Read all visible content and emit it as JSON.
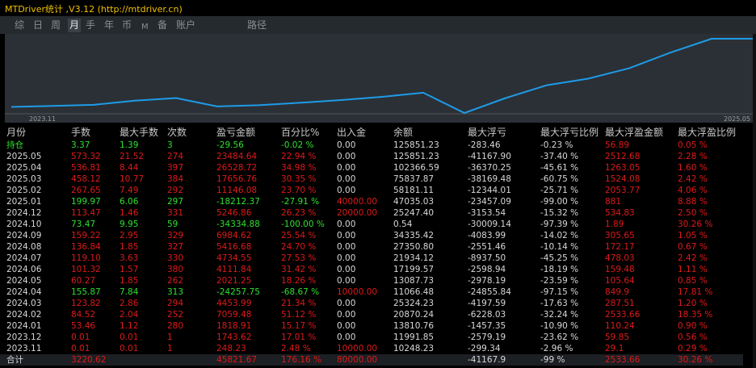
{
  "title": "MTDriver统计 ,V3.12 (http://mtdriver.cn)",
  "tabs": [
    {
      "label": "综"
    },
    {
      "label": "日"
    },
    {
      "label": "周"
    },
    {
      "label": "月",
      "active": true
    },
    {
      "label": "手"
    },
    {
      "label": "年"
    },
    {
      "label": "币"
    },
    {
      "label": "M"
    },
    {
      "label": "备"
    },
    {
      "label": "账户"
    },
    {
      "label": "路径"
    }
  ],
  "chart_data": {
    "type": "line",
    "x": [
      "2023.11",
      "2023.12",
      "2024.01",
      "2024.02",
      "2024.03",
      "2024.04",
      "2024.05",
      "2024.06",
      "2024.07",
      "2024.08",
      "2024.09",
      "2024.10",
      "2024.11",
      "2024.12",
      "2025.01",
      "2025.02",
      "2025.03",
      "2025.04",
      "2025.05"
    ],
    "y": [
      10248.23,
      11991.85,
      13810.76,
      20870.24,
      25324.23,
      11066.48,
      13087.73,
      17199.57,
      21934.12,
      27350.8,
      34335.42,
      0.54,
      25247.4,
      47035.03,
      58181.11,
      75837.87,
      102366.59,
      125851.23,
      125851.23
    ],
    "x_tick_labels": [
      "2023.11",
      "2025.05"
    ],
    "line_color": "#1e9be8"
  },
  "columns": [
    "月份",
    "手数",
    "最大手数",
    "次数",
    "盈亏金额",
    "百分比%",
    "出入金",
    "余额",
    "最大浮亏",
    "最大浮亏比例",
    "最大浮盈金额",
    "最大浮盈比例"
  ],
  "holding": [
    "持仓",
    "3.37",
    "1.39",
    "3",
    "-29.56",
    "-0.02 %",
    "0.00",
    "125851.23",
    "-283.46",
    "-0.23 %",
    "56.89",
    "0.05 %"
  ],
  "rows": [
    [
      "2025.05",
      "573.32",
      "21.52",
      "274",
      "23484.64",
      "22.94 %",
      "0.00",
      "125851.23",
      "-41167.90",
      "-37.40 %",
      "2512.68",
      "2.28 %"
    ],
    [
      "2025.04",
      "536.81",
      "8.44",
      "397",
      "26528.72",
      "34.98 %",
      "0.00",
      "102366.59",
      "-36370.25",
      "-45.61 %",
      "1263.05",
      "1.60 %"
    ],
    [
      "2025.03",
      "458.12",
      "10.77",
      "384",
      "17656.76",
      "30.35 %",
      "0.00",
      "75837.87",
      "-38169.48",
      "-60.75 %",
      "1524.08",
      "2.42 %"
    ],
    [
      "2025.02",
      "267.65",
      "7.49",
      "292",
      "11146.08",
      "23.70 %",
      "0.00",
      "58181.11",
      "-12344.01",
      "-25.71 %",
      "2053.77",
      "4.06 %"
    ],
    [
      "2025.01",
      "199.97",
      "6.06",
      "297",
      "-18212.37",
      "-27.91 %",
      "40000.00",
      "47035.03",
      "-23457.09",
      "-99.00 %",
      "881",
      "8.88 %"
    ],
    [
      "2024.12",
      "113.47",
      "1.46",
      "331",
      "5246.86",
      "26.23 %",
      "20000.00",
      "25247.40",
      "-3153.54",
      "-15.32 %",
      "534.83",
      "2.50 %"
    ],
    [
      "2024.10",
      "73.47",
      "9.95",
      "59",
      "-34334.88",
      "-100.00 %",
      "0.00",
      "0.54",
      "-30009.14",
      "-97.39 %",
      "1.89",
      "30.26 %"
    ],
    [
      "2024.09",
      "159.22",
      "2.95",
      "329",
      "6984.62",
      "25.54 %",
      "0.00",
      "34335.42",
      "-4083.99",
      "-14.02 %",
      "305.65",
      "1.05 %"
    ],
    [
      "2024.08",
      "136.84",
      "1.85",
      "327",
      "5416.68",
      "24.70 %",
      "0.00",
      "27350.80",
      "-2551.46",
      "-10.14 %",
      "172.17",
      "0.67 %"
    ],
    [
      "2024.07",
      "119.10",
      "3.63",
      "330",
      "4734.55",
      "27.53 %",
      "0.00",
      "21934.12",
      "-8937.50",
      "-45.25 %",
      "478.03",
      "2.42 %"
    ],
    [
      "2024.06",
      "101.32",
      "1.57",
      "380",
      "4111.84",
      "31.42 %",
      "0.00",
      "17199.57",
      "-2598.94",
      "-18.19 %",
      "159.48",
      "1.11 %"
    ],
    [
      "2024.05",
      "60.27",
      "1.85",
      "262",
      "2021.25",
      "18.26 %",
      "0.00",
      "13087.73",
      "-2978.19",
      "-23.59 %",
      "105.64",
      "0.85 %"
    ],
    [
      "2024.04",
      "155.87",
      "7.84",
      "313",
      "-24257.75",
      "-68.67 %",
      "10000.00",
      "11066.48",
      "-24855.84",
      "-97.15 %",
      "849.9",
      "17.81 %"
    ],
    [
      "2024.03",
      "123.82",
      "2.86",
      "294",
      "4453.99",
      "21.34 %",
      "0.00",
      "25324.23",
      "-4197.59",
      "-17.63 %",
      "287.51",
      "1.20 %"
    ],
    [
      "2024.02",
      "84.52",
      "2.04",
      "252",
      "7059.48",
      "51.12 %",
      "0.00",
      "20870.24",
      "-6228.03",
      "-32.24 %",
      "2533.66",
      "18.35 %"
    ],
    [
      "2024.01",
      "53.46",
      "1.12",
      "280",
      "1818.91",
      "15.17 %",
      "0.00",
      "13810.76",
      "-1457.35",
      "-10.90 %",
      "110.24",
      "0.90 %"
    ],
    [
      "2023.12",
      "0.01",
      "0.01",
      "1",
      "1743.62",
      "17.01 %",
      "0.00",
      "11991.85",
      "-2579.19",
      "-23.62 %",
      "59.85",
      "0.56 %"
    ],
    [
      "2023.11",
      "0.01",
      "0.01",
      "1",
      "248.23",
      "2.48 %",
      "10000.00",
      "10248.23",
      "-299.34",
      "-2.96 %",
      "29.1",
      "0.29 %"
    ]
  ],
  "total": [
    "合计",
    "3220.62",
    "",
    "",
    "45821.67",
    "176.16 %",
    "80000.00",
    "",
    "-41167.9",
    "-99 %",
    "2533.66",
    "30.26 %"
  ],
  "colors": {
    "title": "#f0c000",
    "green": "#2ee02e",
    "red": "#dd1a1a",
    "white": "#d8d8d8",
    "tab_bg": "#252a2f",
    "chart_bg": "#2b3036"
  }
}
